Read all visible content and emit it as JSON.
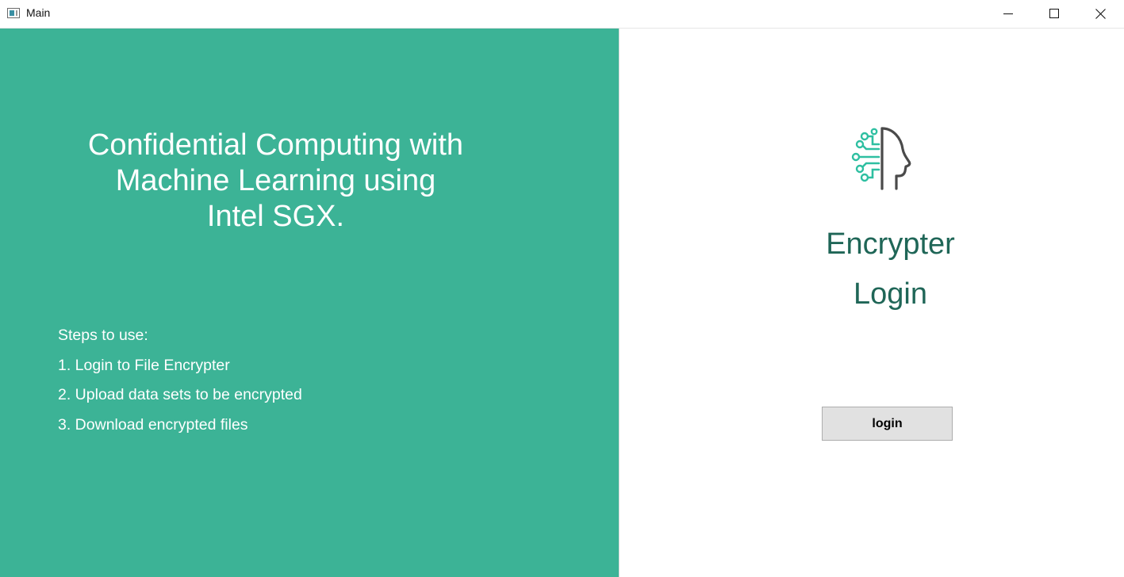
{
  "window": {
    "title": "Main",
    "controls": {
      "minimize_icon": "minimize-icon",
      "maximize_icon": "maximize-icon",
      "close_icon": "close-icon"
    }
  },
  "left_panel": {
    "background": "#3cb396",
    "headline": [
      "Confidential Computing with",
      "Machine Learning using",
      "Intel SGX."
    ],
    "steps_title": "Steps to use:",
    "steps": [
      "1. Login to File Encrypter",
      "2. Upload data sets to be encrypted",
      "3. Download encrypted files"
    ]
  },
  "right_panel": {
    "logo_icon": "ai-head-circuit-icon",
    "brand_line1": "Encrypter",
    "brand_line2": "Login",
    "brand_color": "#1f6657",
    "accent_color": "#2ebfa1",
    "login_button": "login"
  }
}
